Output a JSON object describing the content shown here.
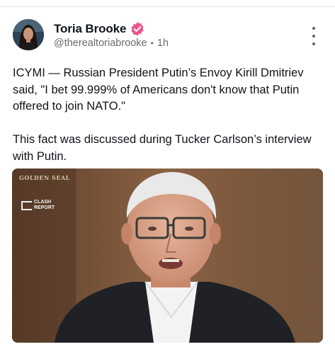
{
  "author": {
    "display_name": "Toria Brooke",
    "handle": "@therealtoriabrooke",
    "time_ago": "1h",
    "verified": true,
    "avatar_icon": "profile-photo",
    "verified_icon": "verified-badge-icon"
  },
  "post": {
    "text": "ICYMI — Russian President Putin’s Envoy Kirill Dmitriev said, \"I bet 99.999% of Americans don't know that Putin offered to join NATO.\"\n\nThis fact was discussed during Tucker Carlson’s interview with Putin."
  },
  "media": {
    "watermark_top": "GOLDEN SEAL",
    "logo_line1": "CLASH",
    "logo_line2": "REPORT"
  },
  "menu": {
    "icon": "more-vertical-icon"
  },
  "colors": {
    "verified_badge": "#f0548f",
    "text_primary": "#0f1419",
    "text_secondary": "#666b70"
  }
}
